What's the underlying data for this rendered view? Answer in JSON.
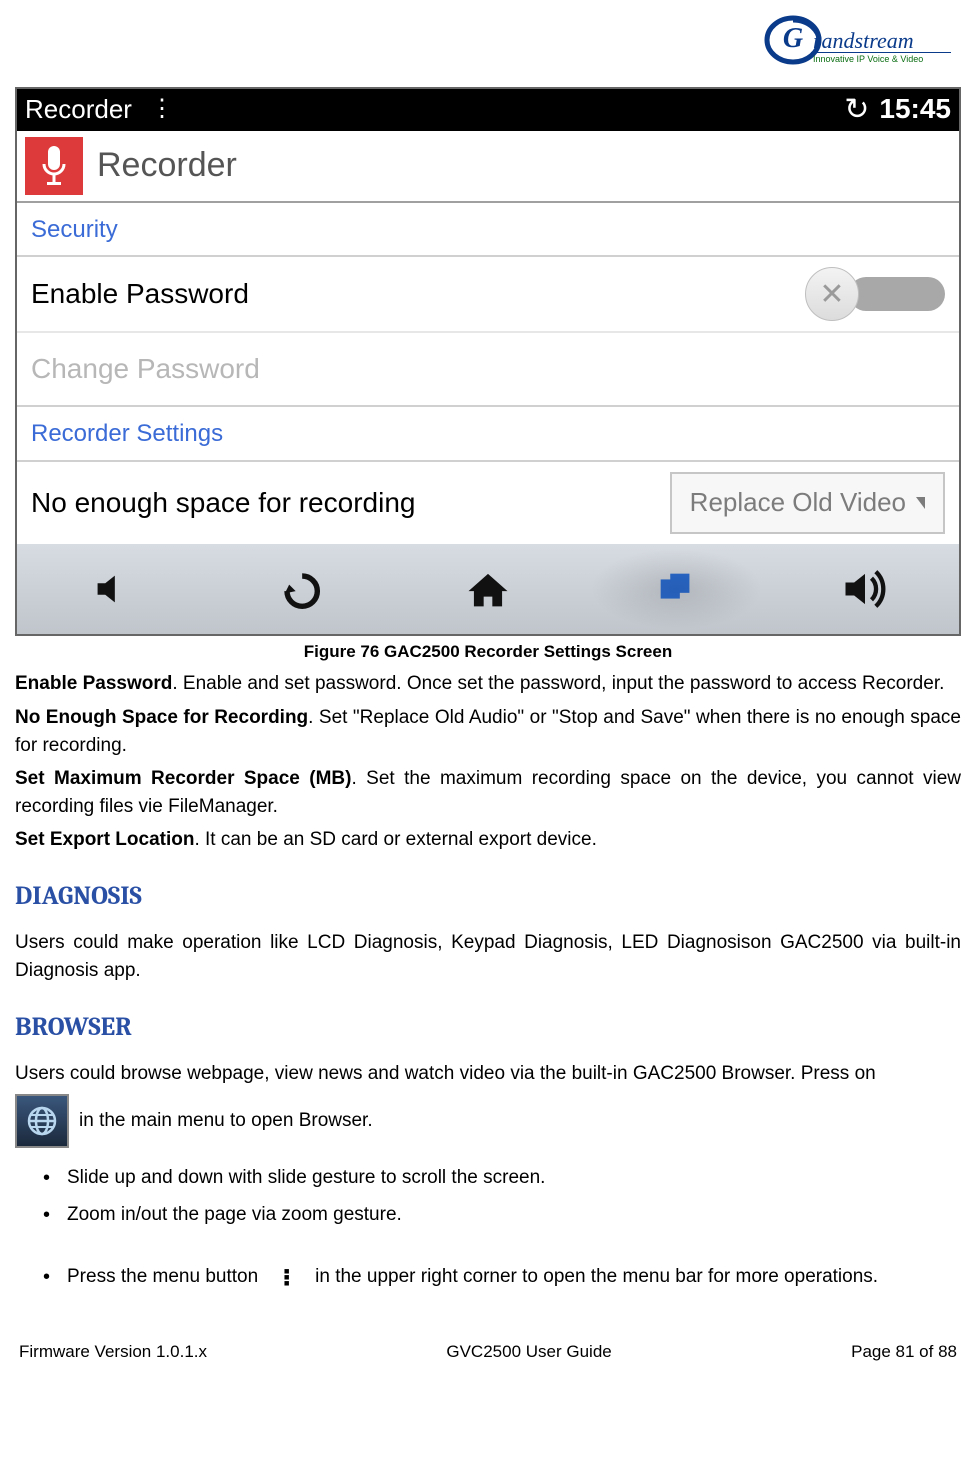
{
  "logo": {
    "brand": "Grandstream",
    "tagline": "Innovative IP Voice & Video"
  },
  "device": {
    "statusbar": {
      "title": "Recorder",
      "clock": "15:45"
    },
    "app_title": "Recorder",
    "section_security": "Security",
    "enable_password": "Enable Password",
    "change_password": "Change Password",
    "section_recorder_settings": "Recorder Settings",
    "no_space_label": "No enough space for recording",
    "spinner_value": "Replace Old Video"
  },
  "caption": "Figure 76 GAC2500 Recorder Settings Screen",
  "body": {
    "p1_b": "Enable Password",
    "p1": ". Enable and set password. Once set the password, input the password to access Recorder.",
    "p2_b": "No Enough Space for Recording",
    "p2": ". Set \"Replace Old Audio\" or \"Stop and Save\" when there is no enough space for recording.",
    "p3_b": "Set Maximum Recorder Space (MB)",
    "p3": ". Set the maximum recording space on the device, you cannot view recording files vie FileManager.",
    "p4_b": "Set Export Location",
    "p4": ". It can be an SD card or external export device."
  },
  "h_diagnosis": "DIAGNOSIS",
  "diagnosis_text": "Users could make operation like LCD Diagnosis, Keypad Diagnosis, LED Diagnosison GAC2500 via built-in Diagnosis app.",
  "h_browser": "BROWSER",
  "browser_intro": "Users could browse webpage, view news and watch video via the built-in GAC2500 Browser. Press on",
  "browser_intro2": " in the main menu to open Browser.",
  "bullets": [
    "Slide up and down with slide gesture to scroll the screen.",
    "Zoom in/out the page via zoom gesture."
  ],
  "bullet3_a": "Press the menu button ",
  "bullet3_b": " in the upper right corner to open the menu bar for more operations.",
  "footer": {
    "left": "Firmware Version 1.0.1.x",
    "center": "GVC2500 User Guide",
    "right": "Page 81 of 88"
  }
}
